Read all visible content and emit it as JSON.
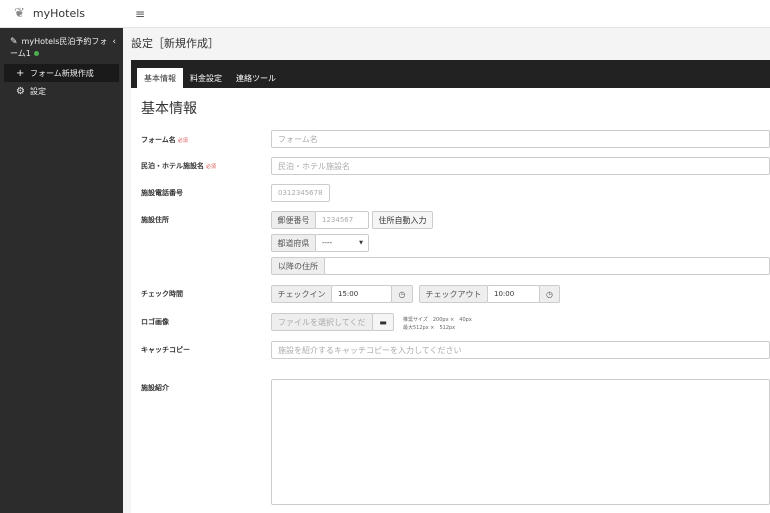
{
  "brand": {
    "name": "myHotels"
  },
  "sidebar": {
    "form_name": "myHotels民泊予約フォーム1",
    "items": [
      {
        "label": "フォーム新規作成"
      },
      {
        "label": "設定"
      }
    ]
  },
  "topbar": {
    "menu_icon": "≡"
  },
  "page": {
    "title": "設定［新規作成］"
  },
  "tabs": [
    {
      "label": "基本情報"
    },
    {
      "label": "料金設定"
    },
    {
      "label": "連絡ツール"
    }
  ],
  "form": {
    "section_title": "基本情報",
    "required_mark": "必須",
    "form_name": {
      "label": "フォーム名",
      "placeholder": "フォーム名"
    },
    "facility_name": {
      "label": "民泊・ホテル施設名",
      "placeholder": "民泊・ホテル施設名"
    },
    "phone": {
      "label": "施設電話番号",
      "placeholder": "0312345678"
    },
    "address": {
      "label": "施設住所",
      "postal_label": "郵便番号",
      "postal_placeholder": "1234567",
      "auto_fill": "住所自動入力",
      "pref_label": "都道府県",
      "pref_value": "----",
      "rest_label": "以降の住所"
    },
    "check_time": {
      "label": "チェック時間",
      "in_label": "チェックイン",
      "in_value": "15:00",
      "out_label": "チェックアウト",
      "out_value": "10:00"
    },
    "logo": {
      "label": "ロゴ画像",
      "placeholder": "ファイルを選択してくだ",
      "hint1": "推奨サイズ　200px ×　40px",
      "hint2": "最大512px ×　512px"
    },
    "catch_copy": {
      "label": "キャッチコピー",
      "placeholder": "施設を紹介するキャッチコピーを入力してください"
    },
    "intro": {
      "label": "施設紹介"
    }
  }
}
